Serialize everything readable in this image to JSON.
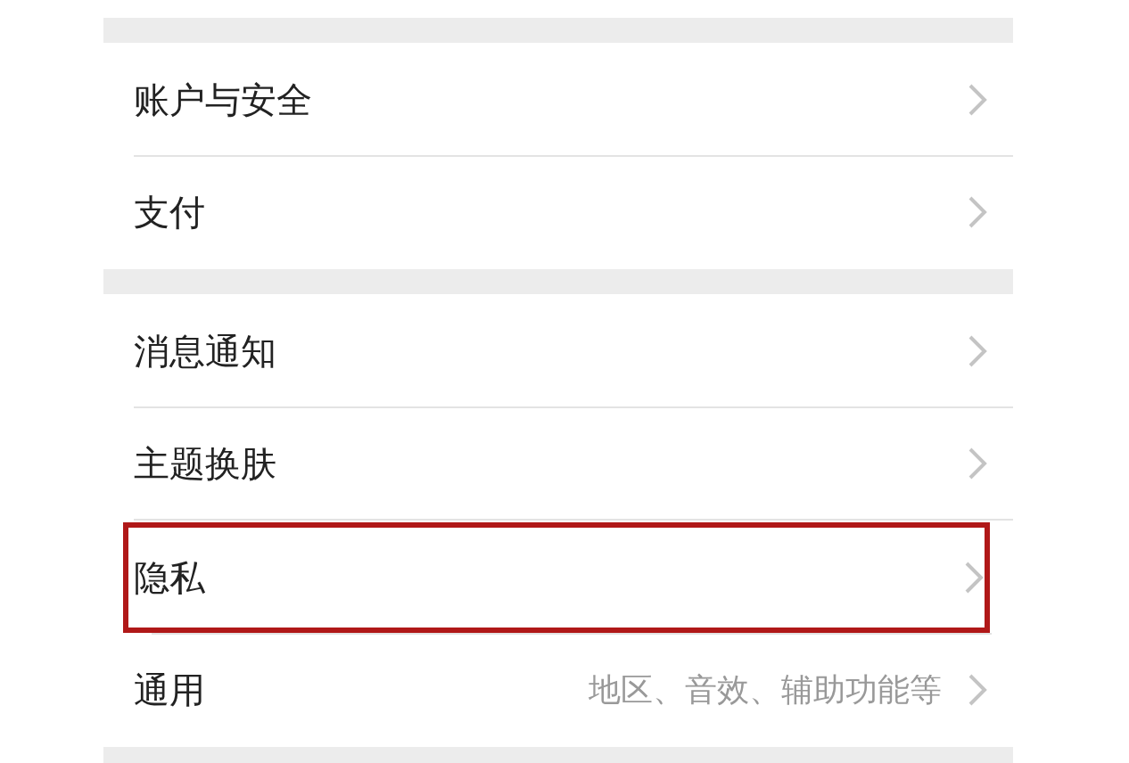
{
  "groups": [
    {
      "rows": [
        {
          "label": "账户与安全",
          "detail": null,
          "highlighted": false
        },
        {
          "label": "支付",
          "detail": null,
          "highlighted": false
        }
      ]
    },
    {
      "rows": [
        {
          "label": "消息通知",
          "detail": null,
          "highlighted": false
        },
        {
          "label": "主题换肤",
          "detail": null,
          "highlighted": false
        },
        {
          "label": "隐私",
          "detail": null,
          "highlighted": true
        },
        {
          "label": "通用",
          "detail": "地区、音效、辅助功能等",
          "highlighted": false
        }
      ]
    }
  ]
}
